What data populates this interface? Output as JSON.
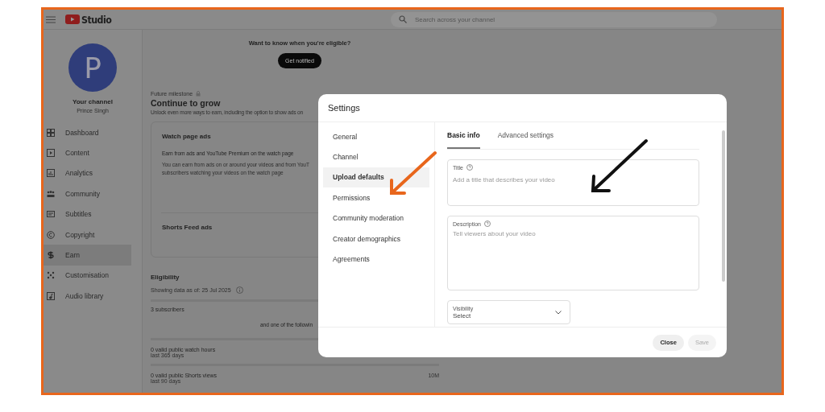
{
  "header": {
    "logo_text": "Studio",
    "search_placeholder": "Search across your channel"
  },
  "channel": {
    "avatar_letter": "P",
    "title": "Your channel",
    "name": "Prince Singh"
  },
  "sidebar": {
    "items": [
      {
        "label": "Dashboard",
        "kind": "dashboard",
        "selected": false
      },
      {
        "label": "Content",
        "kind": "content",
        "selected": false
      },
      {
        "label": "Analytics",
        "kind": "analytics",
        "selected": false
      },
      {
        "label": "Community",
        "kind": "community",
        "selected": false
      },
      {
        "label": "Subtitles",
        "kind": "subtitles",
        "selected": false
      },
      {
        "label": "Copyright",
        "kind": "copyright",
        "selected": false
      },
      {
        "label": "Earn",
        "kind": "earn",
        "selected": true
      },
      {
        "label": "Customisation",
        "kind": "customisation",
        "selected": false
      },
      {
        "label": "Audio library",
        "kind": "audio",
        "selected": false
      }
    ]
  },
  "notify": {
    "text": "Want to know when you're eligible?",
    "button": "Get notified"
  },
  "milestone": {
    "label": "Future milestone",
    "title": "Continue to grow",
    "description": "Unlock even more ways to earn, including the option to show ads on"
  },
  "cards": [
    {
      "title": "Watch page ads",
      "subtitle": "Earn from ads and YouTube Premium on the watch page",
      "body": [
        "You can earn from ads on or around your videos and from YouT",
        "subscribers watching your videos on the watch page"
      ]
    },
    {
      "title": "Shorts Feed ads"
    }
  ],
  "eligibility": {
    "title": "Eligibility",
    "date_note": "Showing data as of: 25 Jul 2025",
    "subscribers": "3 subscribers",
    "or_text": "and one of the followin",
    "metrics": [
      {
        "label": "0 valid public watch hours",
        "period": "last 365 days"
      },
      {
        "label": "0 valid public Shorts views",
        "period": "last 90 days",
        "target": "10M"
      }
    ]
  },
  "dialog": {
    "title": "Settings",
    "nav": [
      {
        "label": "General",
        "selected": false
      },
      {
        "label": "Channel",
        "selected": false
      },
      {
        "label": "Upload defaults",
        "selected": true
      },
      {
        "label": "Permissions",
        "selected": false
      },
      {
        "label": "Community moderation",
        "selected": false
      },
      {
        "label": "Creator demographics",
        "selected": false
      },
      {
        "label": "Agreements",
        "selected": false
      }
    ],
    "tabs": [
      {
        "label": "Basic info",
        "selected": true
      },
      {
        "label": "Advanced settings",
        "selected": false
      }
    ],
    "fields": [
      {
        "kind": "text",
        "label": "Title",
        "placeholder": "Add a title that describes your video"
      },
      {
        "kind": "textarea",
        "label": "Description",
        "placeholder": "Tell viewers about your video"
      },
      {
        "kind": "select",
        "label": "Visibility",
        "value": "Select"
      }
    ],
    "buttons": [
      {
        "label": "Close",
        "disabled": false
      },
      {
        "label": "Save",
        "disabled": true
      }
    ]
  },
  "annotations": [
    {
      "kind": "arrow",
      "color": "#e8661c"
    },
    {
      "kind": "arrow",
      "color": "#111111"
    }
  ]
}
